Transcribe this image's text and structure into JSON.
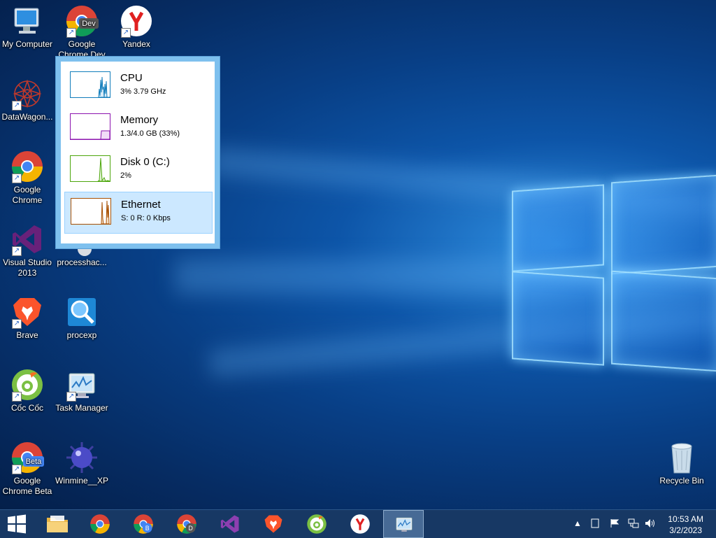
{
  "desktop": {
    "icons": [
      {
        "label": "My Computer"
      },
      {
        "label": "Google Chrome Dev",
        "badge": "Dev"
      },
      {
        "label": "Yandex"
      },
      {
        "label": "DataWagon..."
      },
      {
        "label": "Google Chrome"
      },
      {
        "label": "Visual Studio 2013"
      },
      {
        "label": "processhac..."
      },
      {
        "label": "Brave"
      },
      {
        "label": "procexp"
      },
      {
        "label": "Cốc Cốc"
      },
      {
        "label": "Task Manager"
      },
      {
        "label": "Google Chrome Beta",
        "badge": "Beta"
      },
      {
        "label": "Winmine__XP"
      },
      {
        "label": "Recycle Bin"
      }
    ]
  },
  "perf_popup": {
    "items": [
      {
        "title": "CPU",
        "detail": "3% 3.79 GHz",
        "color": "#117dbb"
      },
      {
        "title": "Memory",
        "detail": "1.3/4.0 GB (33%)",
        "color": "#8b12ae"
      },
      {
        "title": "Disk 0 (C:)",
        "detail": "2%",
        "color": "#4da60c"
      },
      {
        "title": "Ethernet",
        "detail": "S: 0 R: 0 Kbps",
        "color": "#a74f01"
      }
    ]
  },
  "taskbar": {
    "pinned": [
      "windows-start",
      "file-explorer",
      "google-chrome",
      "google-chrome-beta",
      "google-chrome-dev",
      "visual-studio",
      "brave",
      "coc-coc",
      "yandex",
      "task-manager"
    ],
    "tray_icons": [
      "show-hidden-icons",
      "tablet-icon",
      "flag-icon",
      "network-icon",
      "volume-icon"
    ],
    "clock": {
      "time": "10:53 AM",
      "date": "3/2/2023"
    }
  }
}
